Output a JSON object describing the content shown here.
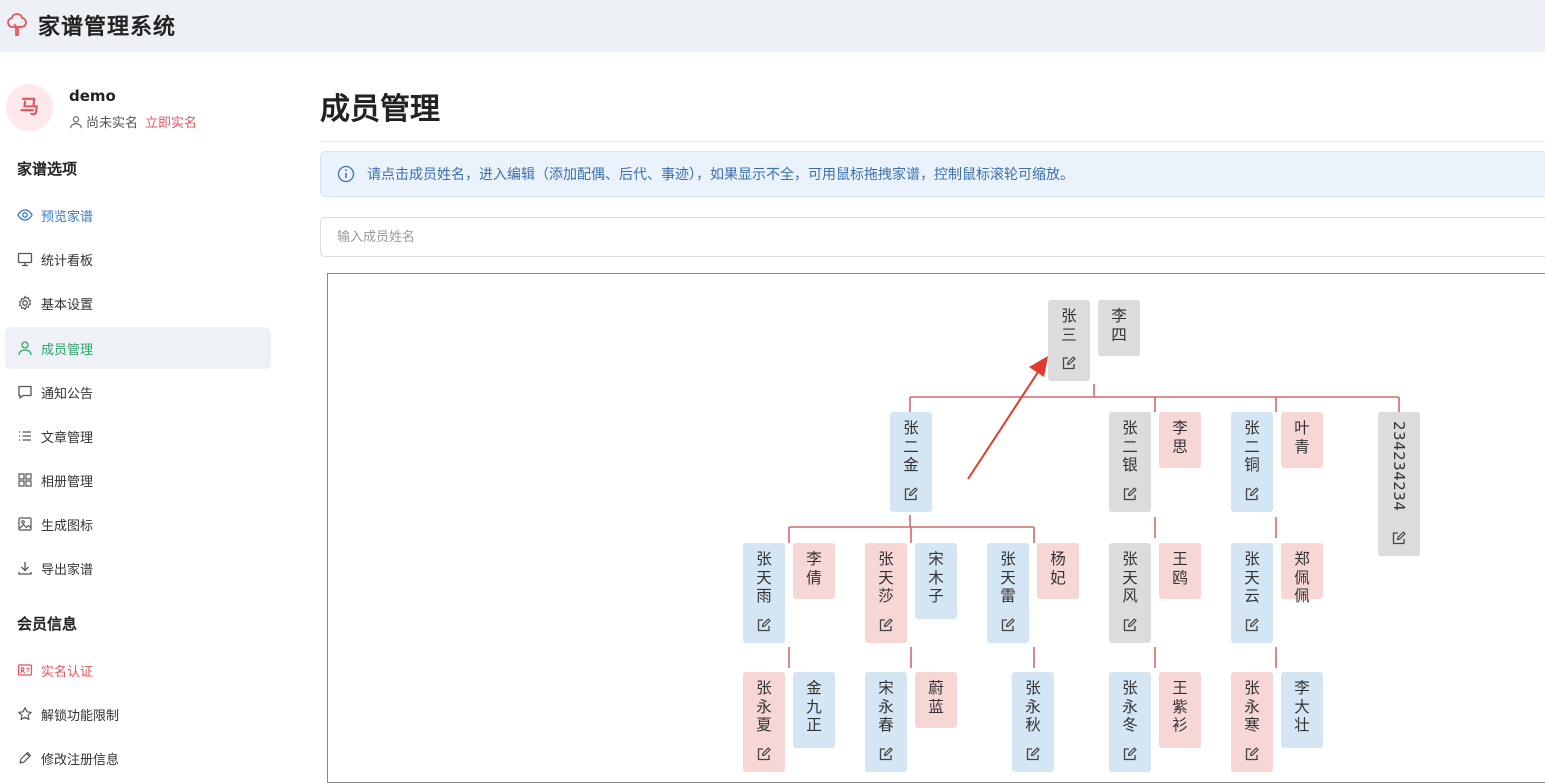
{
  "app": {
    "title": "家谱管理系统",
    "logo_icon": "tree-icon",
    "accent": "#e25563"
  },
  "user": {
    "avatar_text": "马",
    "name": "demo",
    "status": "尚未实名",
    "verify_link": "立即实名"
  },
  "sidebar": {
    "section1": "家谱选项",
    "items": [
      {
        "label": "预览家谱",
        "icon": "eye-icon"
      },
      {
        "label": "统计看板",
        "icon": "monitor-icon"
      },
      {
        "label": "基本设置",
        "icon": "gear-icon"
      },
      {
        "label": "成员管理",
        "icon": "user-icon",
        "active": true
      },
      {
        "label": "通知公告",
        "icon": "chat-icon"
      },
      {
        "label": "文章管理",
        "icon": "list-icon"
      },
      {
        "label": "相册管理",
        "icon": "grid-icon"
      },
      {
        "label": "生成图标",
        "icon": "image-icon"
      },
      {
        "label": "导出家谱",
        "icon": "download-icon"
      }
    ],
    "section2": "会员信息",
    "items2": [
      {
        "label": "实名认证",
        "icon": "id-card-icon"
      },
      {
        "label": "解锁功能限制",
        "icon": "star-icon"
      },
      {
        "label": "修改注册信息",
        "icon": "pen-icon"
      }
    ]
  },
  "main": {
    "title": "成员管理",
    "info": "请点击成员姓名，进入编辑（添加配偶、后代、事迹），如果显示不全，可用鼠标拖拽家谱，控制鼠标滚轮可缩放。",
    "search_placeholder": "输入成员姓名"
  },
  "tree": {
    "line_color": "#d46a6a",
    "nodes": [
      {
        "name": "张三",
        "color": "gray",
        "edit": true
      },
      {
        "name": "李四",
        "color": "gray",
        "edit": false
      },
      {
        "name": "张二金",
        "color": "blue",
        "edit": true
      },
      {
        "name": "张二银",
        "color": "gray",
        "edit": true
      },
      {
        "name": "李思",
        "color": "pink",
        "edit": false
      },
      {
        "name": "张二铜",
        "color": "blue",
        "edit": true
      },
      {
        "name": "叶青",
        "color": "pink",
        "edit": false
      },
      {
        "name": "234234234",
        "color": "gray",
        "edit": true
      },
      {
        "name": "张天雨",
        "color": "blue",
        "edit": true
      },
      {
        "name": "李倩",
        "color": "pink",
        "edit": false
      },
      {
        "name": "张天莎",
        "color": "pink",
        "edit": true
      },
      {
        "name": "宋木子",
        "color": "blue",
        "edit": false
      },
      {
        "name": "张天雷",
        "color": "blue",
        "edit": true
      },
      {
        "name": "杨妃",
        "color": "pink",
        "edit": false
      },
      {
        "name": "张天风",
        "color": "gray",
        "edit": true
      },
      {
        "name": "王鸥",
        "color": "pink",
        "edit": false
      },
      {
        "name": "张天云",
        "color": "blue",
        "edit": true
      },
      {
        "name": "郑佩佩",
        "color": "pink",
        "edit": false
      },
      {
        "name": "张永夏",
        "color": "pink",
        "edit": true
      },
      {
        "name": "金九正",
        "color": "blue",
        "edit": false
      },
      {
        "name": "宋永春",
        "color": "blue",
        "edit": true
      },
      {
        "name": "蔚蓝",
        "color": "pink",
        "edit": false
      },
      {
        "name": "张永秋",
        "color": "blue",
        "edit": true
      },
      {
        "name": "张永冬",
        "color": "blue",
        "edit": true
      },
      {
        "name": "王紫衫",
        "color": "pink",
        "edit": false
      },
      {
        "name": "张永寒",
        "color": "pink",
        "edit": true
      },
      {
        "name": "李大壮",
        "color": "blue",
        "edit": false
      }
    ]
  }
}
